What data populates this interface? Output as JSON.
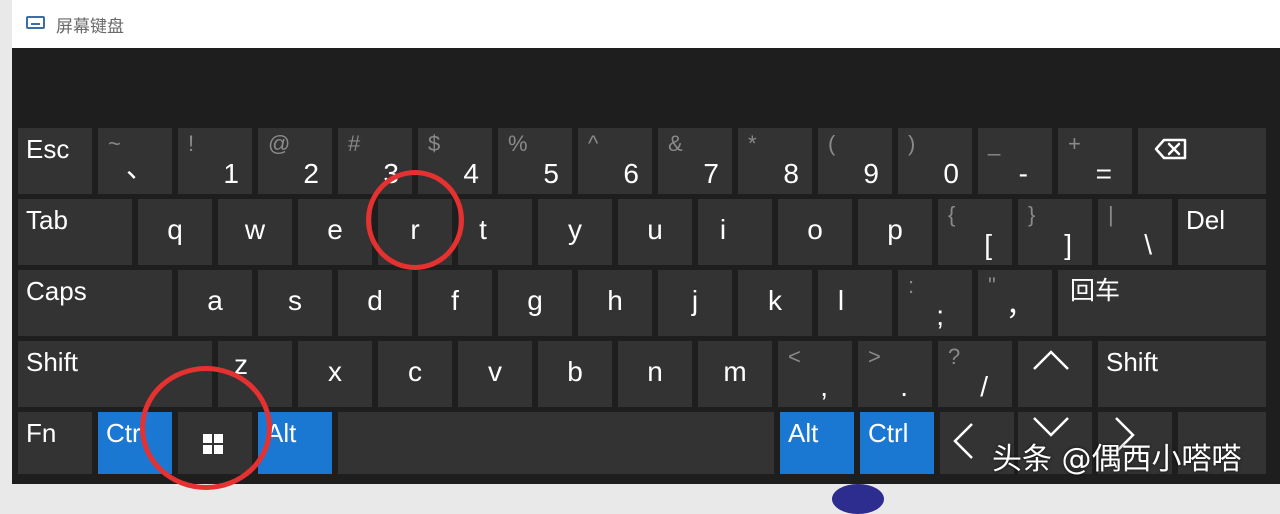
{
  "window": {
    "title": "屏幕键盘"
  },
  "colors": {
    "background": "#1e1e1e",
    "key": "#333333",
    "accent": "#1a78d3",
    "annotation": "#e5312f"
  },
  "keyboard": {
    "esc": "Esc",
    "backtick": {
      "shift": "~",
      "main": "、"
    },
    "n1": {
      "shift": "!",
      "main": "1"
    },
    "n2": {
      "shift": "@",
      "main": "2"
    },
    "n3": {
      "shift": "#",
      "main": "3"
    },
    "n4": {
      "shift": "$",
      "main": "4"
    },
    "n5": {
      "shift": "%",
      "main": "5"
    },
    "n6": {
      "shift": "^",
      "main": "6"
    },
    "n7": {
      "shift": "&",
      "main": "7"
    },
    "n8": {
      "shift": "*",
      "main": "8"
    },
    "n9": {
      "shift": "(",
      "main": "9"
    },
    "n0": {
      "shift": ")",
      "main": "0"
    },
    "minus": {
      "shift": "_",
      "main": "-"
    },
    "equals": {
      "shift": "+",
      "main": "="
    },
    "backspace_icon": "backspace-icon",
    "tab": "Tab",
    "q": "q",
    "w": "w",
    "e": "e",
    "r": "r",
    "t": "t",
    "y": "y",
    "u": "u",
    "i": "i",
    "o": "o",
    "p": "p",
    "lbracket": {
      "shift": "{",
      "main": "["
    },
    "rbracket": {
      "shift": "}",
      "main": "]"
    },
    "backslash": {
      "shift": "|",
      "main": "\\"
    },
    "del": "Del",
    "caps": "Caps",
    "a": "a",
    "s": "s",
    "d": "d",
    "f": "f",
    "g": "g",
    "h": "h",
    "j": "j",
    "k": "k",
    "l": "l",
    "semicolon": {
      "shift": ":",
      "main": ";"
    },
    "quote": {
      "shift": "\"",
      "main": "，"
    },
    "enter": "回车",
    "shift": "Shift",
    "z": "z",
    "x": "x",
    "c": "c",
    "v": "v",
    "b": "b",
    "n": "n",
    "m": "m",
    "comma": {
      "shift": "<",
      "main": ","
    },
    "period": {
      "shift": ">",
      "main": "."
    },
    "slash": {
      "shift": "?",
      "main": "/"
    },
    "fn": "Fn",
    "ctrl": "Ctrl",
    "alt": "Alt",
    "win_icon": "windows-icon",
    "arrows": [
      "left-arrow-icon",
      "up-arrow-icon",
      "down-arrow-icon",
      "right-arrow-icon"
    ]
  },
  "watermark": "头条 @偶西小嗒嗒"
}
